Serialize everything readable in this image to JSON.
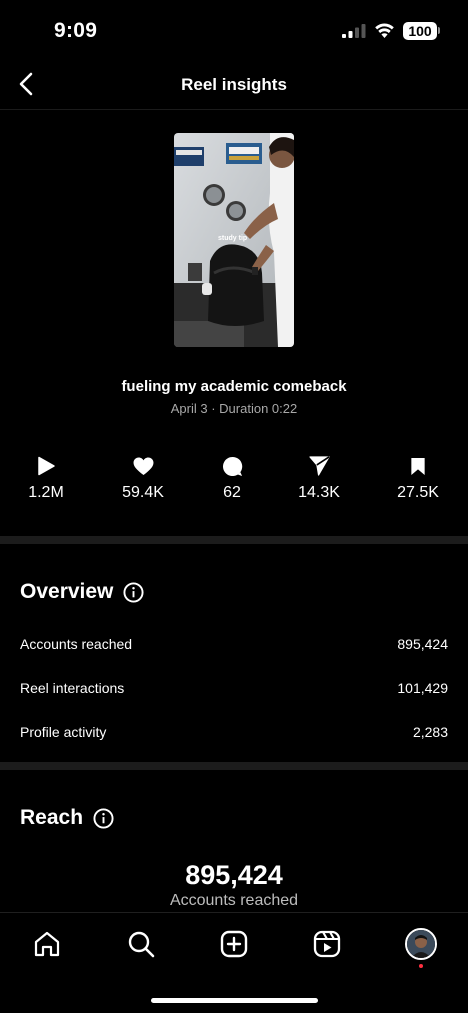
{
  "status_bar": {
    "time": "9:09",
    "battery": "100"
  },
  "header": {
    "title": "Reel insights"
  },
  "reel": {
    "thumbnail_caption": "study tip",
    "title": "fueling my academic comeback",
    "meta": "April 3 · Duration 0:22"
  },
  "stats": [
    {
      "icon": "play-icon",
      "value": "1.2M"
    },
    {
      "icon": "heart-icon",
      "value": "59.4K"
    },
    {
      "icon": "comment-icon",
      "value": "62"
    },
    {
      "icon": "share-icon",
      "value": "14.3K"
    },
    {
      "icon": "bookmark-icon",
      "value": "27.5K"
    }
  ],
  "overview": {
    "title": "Overview",
    "rows": [
      {
        "label": "Accounts reached",
        "value": "895,424"
      },
      {
        "label": "Reel interactions",
        "value": "101,429"
      },
      {
        "label": "Profile activity",
        "value": "2,283"
      }
    ]
  },
  "reach": {
    "title": "Reach",
    "value": "895,424",
    "label": "Accounts reached"
  },
  "tabs": [
    "home-icon",
    "search-icon",
    "create-icon",
    "reels-icon",
    "profile-avatar"
  ]
}
